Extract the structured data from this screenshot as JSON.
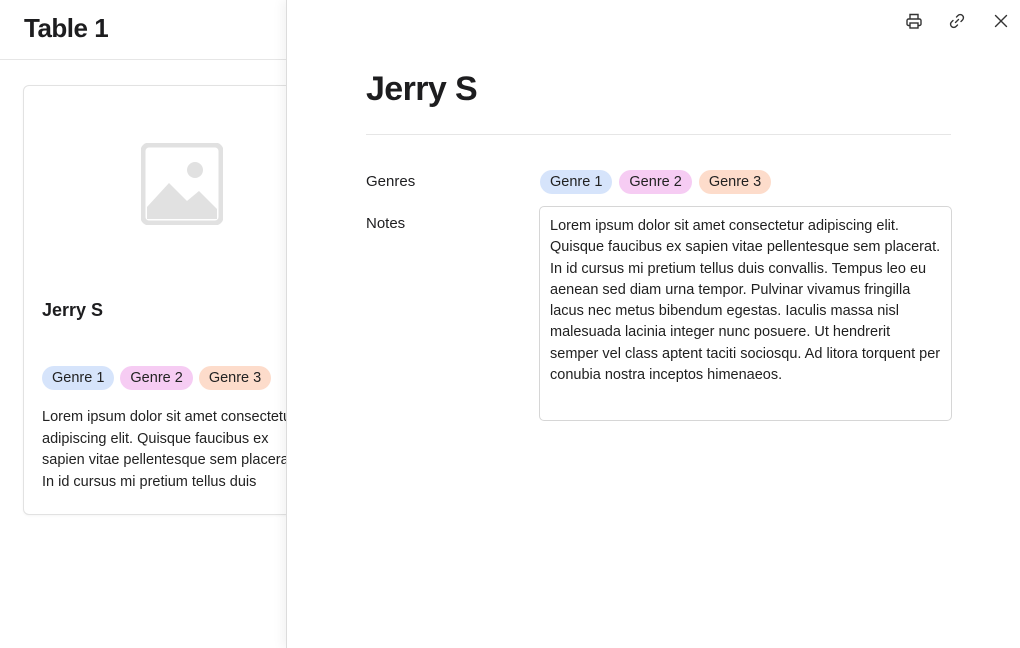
{
  "table": {
    "title": "Table 1"
  },
  "card": {
    "name": "Jerry S",
    "tags": [
      "Genre 1",
      "Genre 2",
      "Genre 3"
    ],
    "notes": "Lorem ipsum dolor sit amet consectetur adipiscing elit. Quisque faucibus ex sapien vitae pellentesque sem placerat. In id cursus mi pretium tellus duis convallis."
  },
  "panel": {
    "title": "Jerry S",
    "actions": {
      "print_icon": "printer-icon",
      "link_icon": "link-icon",
      "close_icon": "close-icon"
    },
    "fields": {
      "genres_label": "Genres",
      "genres": [
        "Genre 1",
        "Genre 2",
        "Genre 3"
      ],
      "notes_label": "Notes",
      "notes": "Lorem ipsum dolor sit amet consectetur adipiscing elit. Quisque faucibus ex sapien vitae pellentesque sem placerat. In id cursus mi pretium tellus duis convallis. Tempus leo eu aenean sed diam urna tempor. Pulvinar vivamus fringilla lacus nec metus bibendum egestas. Iaculis massa nisl malesuada lacinia integer nunc posuere. Ut hendrerit semper vel class aptent taciti sociosqu. Ad litora torquent per conubia nostra inceptos himenaeos."
    }
  },
  "colors": {
    "genre1": "#d6e4fb",
    "genre2": "#f6ccf3",
    "genre3": "#fddccb"
  }
}
